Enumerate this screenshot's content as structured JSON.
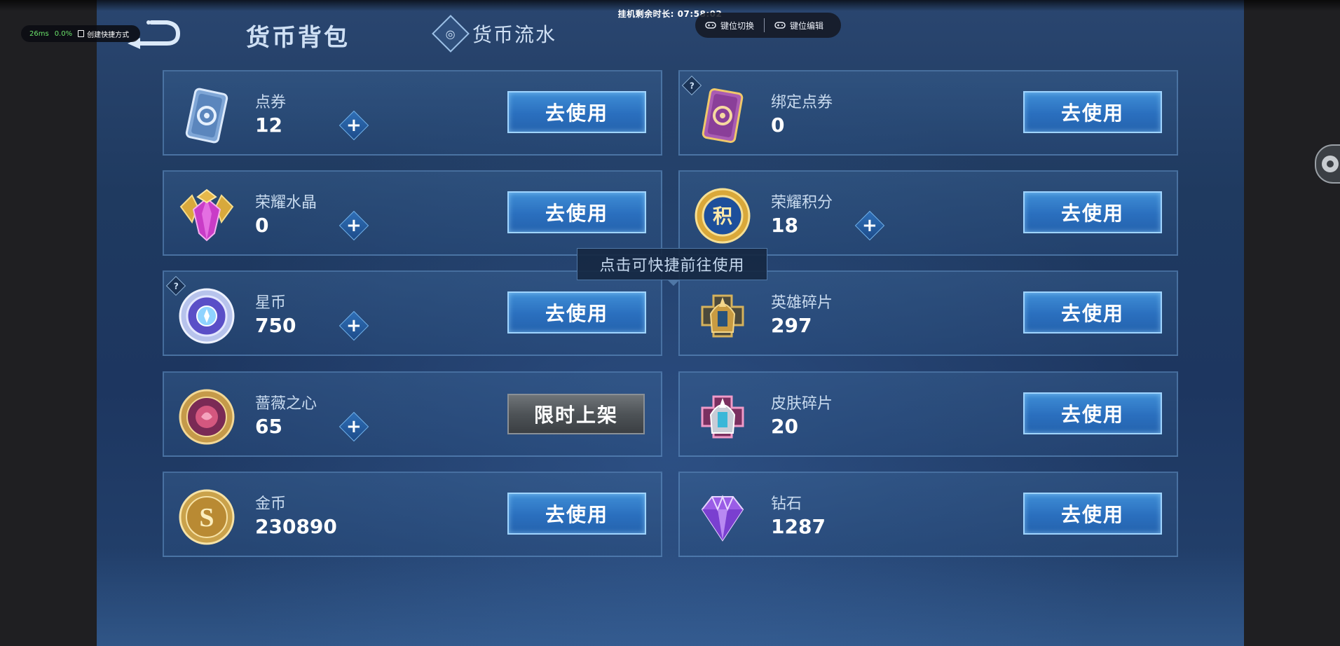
{
  "overlay": {
    "timer_text": "挂机剩余时长: 07:58:02",
    "key_switch_label": "键位切换",
    "key_edit_label": "键位编辑",
    "latency": "26ms",
    "loss": "0.0%",
    "shortcut_label": "创建快捷方式"
  },
  "header": {
    "title": "货币背包",
    "flow_tab_label": "货币流水"
  },
  "tooltip": "点击可快捷前往使用",
  "currencies": [
    {
      "name": "点券",
      "amount": "12",
      "action": "去使用",
      "icon": "voucher-card-icon",
      "has_plus": true
    },
    {
      "name": "绑定点券",
      "amount": "0",
      "action": "去使用",
      "icon": "bound-voucher-card-icon",
      "has_help": true
    },
    {
      "name": "荣耀水晶",
      "amount": "0",
      "action": "去使用",
      "icon": "glory-crystal-icon",
      "has_plus": true
    },
    {
      "name": "荣耀积分",
      "amount": "18",
      "action": "去使用",
      "icon": "glory-points-coin-icon",
      "has_plus": true
    },
    {
      "name": "星币",
      "amount": "750",
      "action": "去使用",
      "icon": "star-coin-icon",
      "has_plus": true,
      "has_help": true
    },
    {
      "name": "英雄碎片",
      "amount": "297",
      "action": "去使用",
      "icon": "hero-fragment-helmet-icon"
    },
    {
      "name": "蔷薇之心",
      "amount": "65",
      "action": "限时上架",
      "icon": "rose-heart-coin-icon",
      "has_plus": true
    },
    {
      "name": "皮肤碎片",
      "amount": "20",
      "action": "去使用",
      "icon": "skin-fragment-helmet-icon"
    },
    {
      "name": "金币",
      "amount": "230890",
      "action": "去使用",
      "icon": "gold-coin-icon"
    },
    {
      "name": "钻石",
      "amount": "1287",
      "action": "去使用",
      "icon": "diamond-icon"
    }
  ],
  "help_glyph": "?",
  "plus_glyph": "+",
  "colors": {
    "button_blue": "#2a6fbe",
    "limited_gray": "#4e5357",
    "panel_bg": "#1f3a60"
  }
}
